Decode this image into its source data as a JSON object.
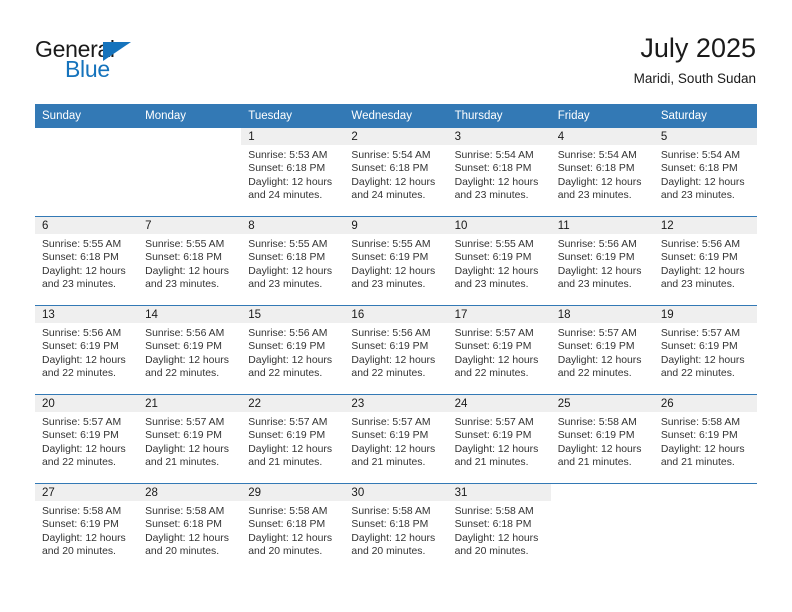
{
  "brand": {
    "name_part1": "General",
    "name_part2": "Blue",
    "accent_color": "#1573bc"
  },
  "header": {
    "title": "July 2025",
    "subtitle": "Maridi, South Sudan"
  },
  "theme": {
    "header_row_color": "#3379b5",
    "daynum_band_color": "#efefef",
    "text_color": "#333333"
  },
  "calendar": {
    "weekday_headers": [
      "Sunday",
      "Monday",
      "Tuesday",
      "Wednesday",
      "Thursday",
      "Friday",
      "Saturday"
    ],
    "weeks": [
      [
        {
          "day": "",
          "lines": []
        },
        {
          "day": "",
          "lines": []
        },
        {
          "day": "1",
          "lines": [
            "Sunrise: 5:53 AM",
            "Sunset: 6:18 PM",
            "Daylight: 12 hours",
            "and 24 minutes."
          ]
        },
        {
          "day": "2",
          "lines": [
            "Sunrise: 5:54 AM",
            "Sunset: 6:18 PM",
            "Daylight: 12 hours",
            "and 24 minutes."
          ]
        },
        {
          "day": "3",
          "lines": [
            "Sunrise: 5:54 AM",
            "Sunset: 6:18 PM",
            "Daylight: 12 hours",
            "and 23 minutes."
          ]
        },
        {
          "day": "4",
          "lines": [
            "Sunrise: 5:54 AM",
            "Sunset: 6:18 PM",
            "Daylight: 12 hours",
            "and 23 minutes."
          ]
        },
        {
          "day": "5",
          "lines": [
            "Sunrise: 5:54 AM",
            "Sunset: 6:18 PM",
            "Daylight: 12 hours",
            "and 23 minutes."
          ]
        }
      ],
      [
        {
          "day": "6",
          "lines": [
            "Sunrise: 5:55 AM",
            "Sunset: 6:18 PM",
            "Daylight: 12 hours",
            "and 23 minutes."
          ]
        },
        {
          "day": "7",
          "lines": [
            "Sunrise: 5:55 AM",
            "Sunset: 6:18 PM",
            "Daylight: 12 hours",
            "and 23 minutes."
          ]
        },
        {
          "day": "8",
          "lines": [
            "Sunrise: 5:55 AM",
            "Sunset: 6:18 PM",
            "Daylight: 12 hours",
            "and 23 minutes."
          ]
        },
        {
          "day": "9",
          "lines": [
            "Sunrise: 5:55 AM",
            "Sunset: 6:19 PM",
            "Daylight: 12 hours",
            "and 23 minutes."
          ]
        },
        {
          "day": "10",
          "lines": [
            "Sunrise: 5:55 AM",
            "Sunset: 6:19 PM",
            "Daylight: 12 hours",
            "and 23 minutes."
          ]
        },
        {
          "day": "11",
          "lines": [
            "Sunrise: 5:56 AM",
            "Sunset: 6:19 PM",
            "Daylight: 12 hours",
            "and 23 minutes."
          ]
        },
        {
          "day": "12",
          "lines": [
            "Sunrise: 5:56 AM",
            "Sunset: 6:19 PM",
            "Daylight: 12 hours",
            "and 23 minutes."
          ]
        }
      ],
      [
        {
          "day": "13",
          "lines": [
            "Sunrise: 5:56 AM",
            "Sunset: 6:19 PM",
            "Daylight: 12 hours",
            "and 22 minutes."
          ]
        },
        {
          "day": "14",
          "lines": [
            "Sunrise: 5:56 AM",
            "Sunset: 6:19 PM",
            "Daylight: 12 hours",
            "and 22 minutes."
          ]
        },
        {
          "day": "15",
          "lines": [
            "Sunrise: 5:56 AM",
            "Sunset: 6:19 PM",
            "Daylight: 12 hours",
            "and 22 minutes."
          ]
        },
        {
          "day": "16",
          "lines": [
            "Sunrise: 5:56 AM",
            "Sunset: 6:19 PM",
            "Daylight: 12 hours",
            "and 22 minutes."
          ]
        },
        {
          "day": "17",
          "lines": [
            "Sunrise: 5:57 AM",
            "Sunset: 6:19 PM",
            "Daylight: 12 hours",
            "and 22 minutes."
          ]
        },
        {
          "day": "18",
          "lines": [
            "Sunrise: 5:57 AM",
            "Sunset: 6:19 PM",
            "Daylight: 12 hours",
            "and 22 minutes."
          ]
        },
        {
          "day": "19",
          "lines": [
            "Sunrise: 5:57 AM",
            "Sunset: 6:19 PM",
            "Daylight: 12 hours",
            "and 22 minutes."
          ]
        }
      ],
      [
        {
          "day": "20",
          "lines": [
            "Sunrise: 5:57 AM",
            "Sunset: 6:19 PM",
            "Daylight: 12 hours",
            "and 22 minutes."
          ]
        },
        {
          "day": "21",
          "lines": [
            "Sunrise: 5:57 AM",
            "Sunset: 6:19 PM",
            "Daylight: 12 hours",
            "and 21 minutes."
          ]
        },
        {
          "day": "22",
          "lines": [
            "Sunrise: 5:57 AM",
            "Sunset: 6:19 PM",
            "Daylight: 12 hours",
            "and 21 minutes."
          ]
        },
        {
          "day": "23",
          "lines": [
            "Sunrise: 5:57 AM",
            "Sunset: 6:19 PM",
            "Daylight: 12 hours",
            "and 21 minutes."
          ]
        },
        {
          "day": "24",
          "lines": [
            "Sunrise: 5:57 AM",
            "Sunset: 6:19 PM",
            "Daylight: 12 hours",
            "and 21 minutes."
          ]
        },
        {
          "day": "25",
          "lines": [
            "Sunrise: 5:58 AM",
            "Sunset: 6:19 PM",
            "Daylight: 12 hours",
            "and 21 minutes."
          ]
        },
        {
          "day": "26",
          "lines": [
            "Sunrise: 5:58 AM",
            "Sunset: 6:19 PM",
            "Daylight: 12 hours",
            "and 21 minutes."
          ]
        }
      ],
      [
        {
          "day": "27",
          "lines": [
            "Sunrise: 5:58 AM",
            "Sunset: 6:19 PM",
            "Daylight: 12 hours",
            "and 20 minutes."
          ]
        },
        {
          "day": "28",
          "lines": [
            "Sunrise: 5:58 AM",
            "Sunset: 6:18 PM",
            "Daylight: 12 hours",
            "and 20 minutes."
          ]
        },
        {
          "day": "29",
          "lines": [
            "Sunrise: 5:58 AM",
            "Sunset: 6:18 PM",
            "Daylight: 12 hours",
            "and 20 minutes."
          ]
        },
        {
          "day": "30",
          "lines": [
            "Sunrise: 5:58 AM",
            "Sunset: 6:18 PM",
            "Daylight: 12 hours",
            "and 20 minutes."
          ]
        },
        {
          "day": "31",
          "lines": [
            "Sunrise: 5:58 AM",
            "Sunset: 6:18 PM",
            "Daylight: 12 hours",
            "and 20 minutes."
          ]
        },
        {
          "day": "",
          "lines": []
        },
        {
          "day": "",
          "lines": []
        }
      ]
    ]
  }
}
